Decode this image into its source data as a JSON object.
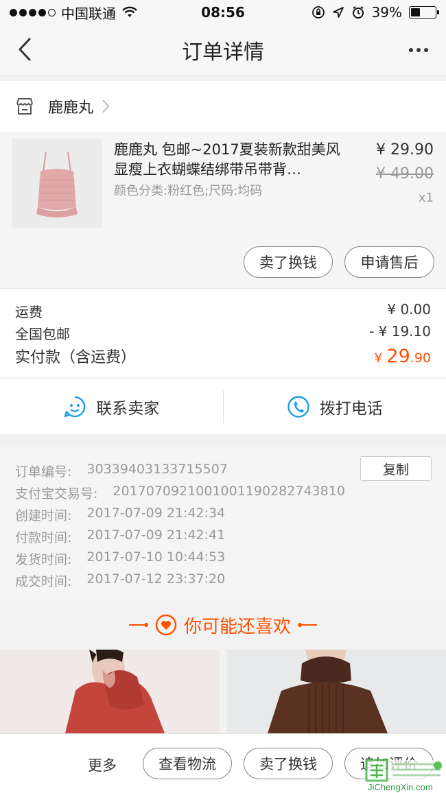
{
  "status_bar": {
    "carrier": "中国联通",
    "time": "08:56",
    "battery": "39%",
    "battery_level": 0.39
  },
  "nav": {
    "title": "订单详情"
  },
  "shop": {
    "name": "鹿鹿丸"
  },
  "product": {
    "title": "鹿鹿丸 包邮~2017夏装新款甜美风显瘦上衣蝴蝶结绑带吊带背…",
    "spec": "颜色分类:粉红色;尺码:均码",
    "price_now": "¥ 29.90",
    "price_old": "¥ 49.00",
    "qty": "x1",
    "buttons": {
      "sell": "卖了换钱",
      "after_sale": "申请售后"
    }
  },
  "summary": {
    "freight_label": "运费",
    "freight_value": "¥ 0.00",
    "ship_label": "全国包邮",
    "ship_value": "- ¥ 19.10",
    "paid_label": "实付款（含运费）",
    "paid_currency": "¥ ",
    "paid_int": "29",
    "paid_dec": ".90"
  },
  "contact": {
    "seller": "联系卖家",
    "phone": "拨打电话"
  },
  "order_info": {
    "copy": "复制",
    "rows": [
      {
        "k": "订单编号:",
        "v": "30339403133715507"
      },
      {
        "k": "支付宝交易号:",
        "v": "2017070921001001190282743810"
      },
      {
        "k": "创建时间:",
        "v": "2017-07-09 21:42:34"
      },
      {
        "k": "付款时间:",
        "v": "2017-07-09 21:42:41"
      },
      {
        "k": "发货时间:",
        "v": "2017-07-10 10:44:53"
      },
      {
        "k": "成交时间:",
        "v": "2017-07-12 23:37:20"
      }
    ]
  },
  "recommend": {
    "title": "你可能还喜欢"
  },
  "bottom": {
    "more": "更多",
    "logistics": "查看物流",
    "sell": "卖了换钱",
    "review": "追加评价"
  },
  "watermark": {
    "text": "JiChengXin.com"
  },
  "colors": {
    "accent": "#ff5000",
    "icon_blue": "#1e9ee6"
  }
}
